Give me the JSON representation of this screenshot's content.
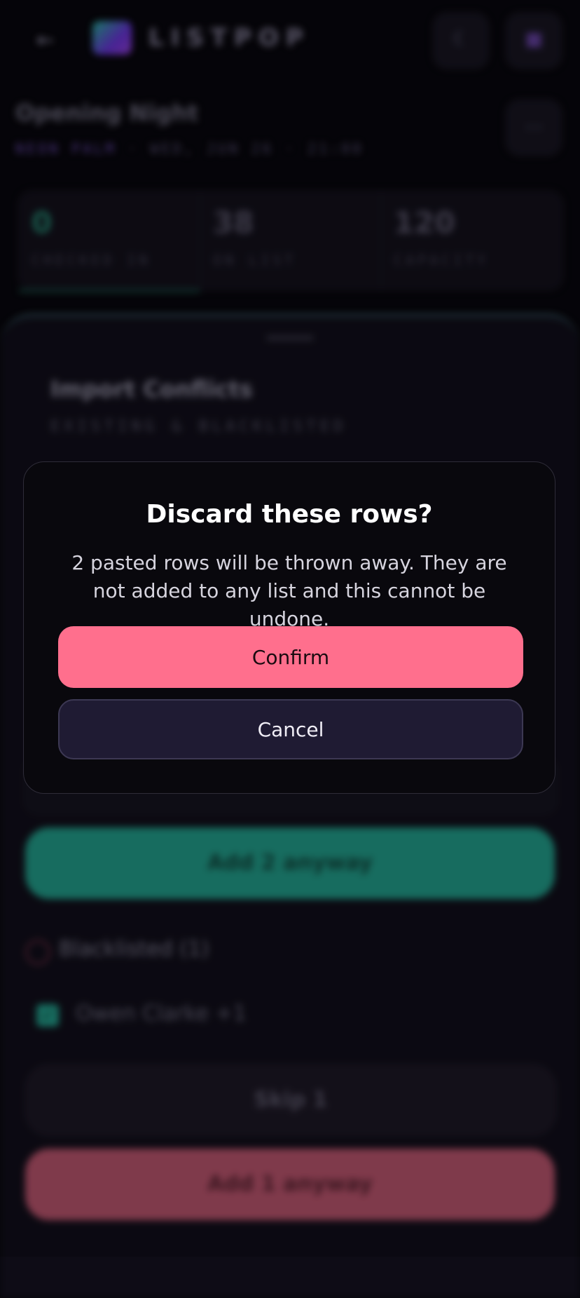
{
  "header": {
    "back_glyph": "←",
    "app_name": "LISTPOP",
    "theme_glyph": "☾",
    "menu_glyph": "▦"
  },
  "event": {
    "title": "Opening Night",
    "venue": "NEON PALM",
    "date": "WED, JUN 26",
    "time": "21:00",
    "separator": "·",
    "more_glyph": "⋯"
  },
  "stats": [
    {
      "value": "0",
      "label": "CHECKED IN"
    },
    {
      "value": "38",
      "label": "ON LIST"
    },
    {
      "value": "120",
      "label": "CAPACITY"
    }
  ],
  "sheet": {
    "title": "Import Conflicts",
    "subtitle": "EXISTING & BLACKLISTED",
    "add_existing_label": "Add 2 anyway",
    "blacklisted_heading": "Blacklisted (1)",
    "blacklisted_guest": "Owen Clarke +1",
    "skip_label": "Skip 1",
    "add_blacklisted_label": "Add 1 anyway"
  },
  "dialog": {
    "title": "Discard these rows?",
    "body": "2 pasted rows will be thrown away. They are not added to any list and this cannot be undone.",
    "confirm_label": "Confirm",
    "cancel_label": "Cancel"
  },
  "colors": {
    "confirm": "#ff6f8d",
    "accent_teal": "#1d8474",
    "danger": "#9c475c"
  }
}
